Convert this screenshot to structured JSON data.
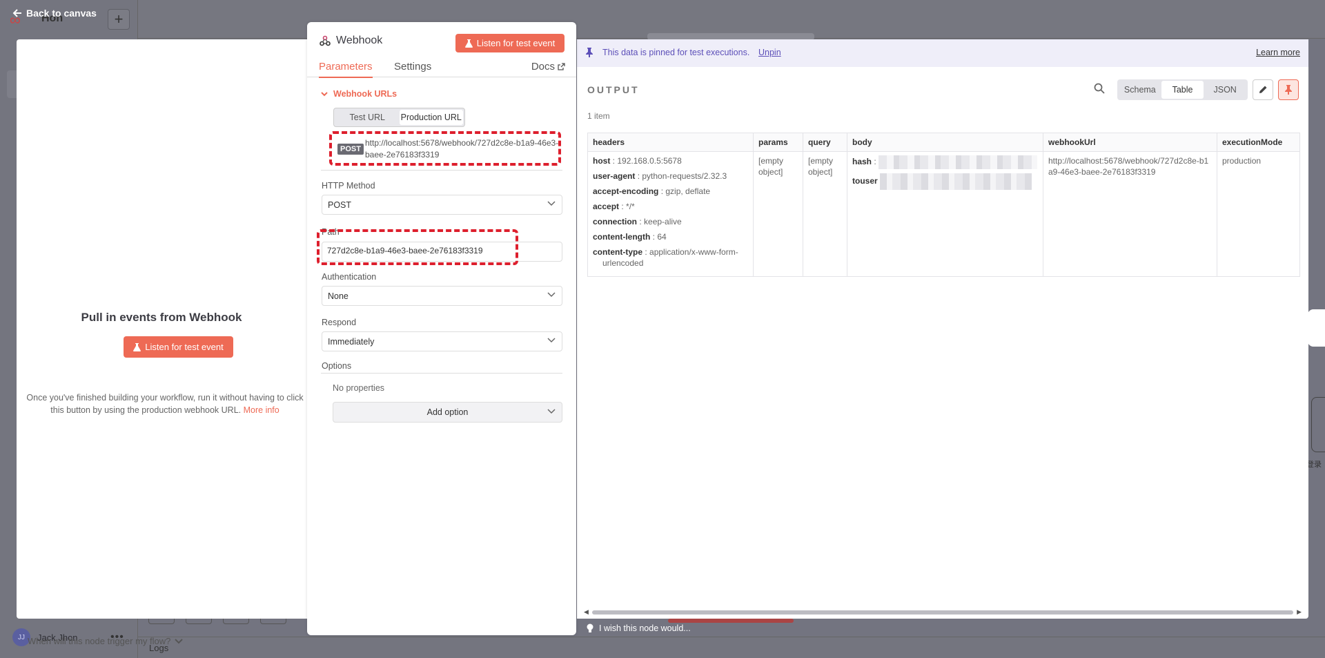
{
  "background": {
    "app_title": "Hon",
    "user_name": "Jack Jhon",
    "user_initials": "JJ",
    "logs_label": "Logs",
    "right_node_label": "登录"
  },
  "back_link": "Back to canvas",
  "left_panel": {
    "title": "Pull in events from Webhook",
    "listen_button": "Listen for test event",
    "description": "Once you've finished building your workflow, run it without having to click this button by using the production webhook URL.",
    "more_info": "More info",
    "when_trigger": "When will this node trigger my flow?"
  },
  "node": {
    "title": "Webhook",
    "listen_button": "Listen for test event",
    "tabs": {
      "parameters": "Parameters",
      "settings": "Settings",
      "docs": "Docs"
    },
    "webhook_urls_label": "Webhook URLs",
    "url_toggle": {
      "test": "Test URL",
      "production": "Production URL",
      "selected": "Production URL"
    },
    "url_method": "POST",
    "url": "http://localhost:5678/webhook/727d2c8e-b1a9-46e3-baee-2e76183f3319",
    "http_method_label": "HTTP Method",
    "http_method_value": "POST",
    "path_label": "Path",
    "path_value": "727d2c8e-b1a9-46e3-baee-2e76183f3319",
    "authentication_label": "Authentication",
    "authentication_value": "None",
    "respond_label": "Respond",
    "respond_value": "Immediately",
    "options_label": "Options",
    "no_properties": "No properties",
    "add_option": "Add option"
  },
  "output": {
    "pin_message": "This data is pinned for test executions.",
    "unpin": "Unpin",
    "learn_more": "Learn more",
    "title": "OUTPUT",
    "items_count": "1 item",
    "views": [
      "Schema",
      "Table",
      "JSON"
    ],
    "selected_view": "Table",
    "columns": [
      "headers",
      "params",
      "query",
      "body",
      "webhookUrl",
      "executionMode"
    ],
    "headers": [
      {
        "key": "host",
        "value": "192.168.0.5:5678"
      },
      {
        "key": "user-agent",
        "value": "python-requests/2.32.3"
      },
      {
        "key": "accept-encoding",
        "value": "gzip, deflate"
      },
      {
        "key": "accept",
        "value": "*/*"
      },
      {
        "key": "connection",
        "value": "keep-alive"
      },
      {
        "key": "content-length",
        "value": "64"
      },
      {
        "key": "content-type",
        "value": "application/x-www-form-urlencoded"
      }
    ],
    "params": "[empty object]",
    "query": "[empty object]",
    "body_keys": [
      "hash",
      "touser"
    ],
    "webhookUrl": "http://localhost:5678/webhook/727d2c8e-b1a9-46e3-baee-2e76183f3319",
    "executionMode": "production"
  },
  "wish_text": "I wish this node would...",
  "colors": {
    "accent": "#ee6a55",
    "highlight": "#dd1f2d",
    "pin_banner": "#efeef9"
  }
}
